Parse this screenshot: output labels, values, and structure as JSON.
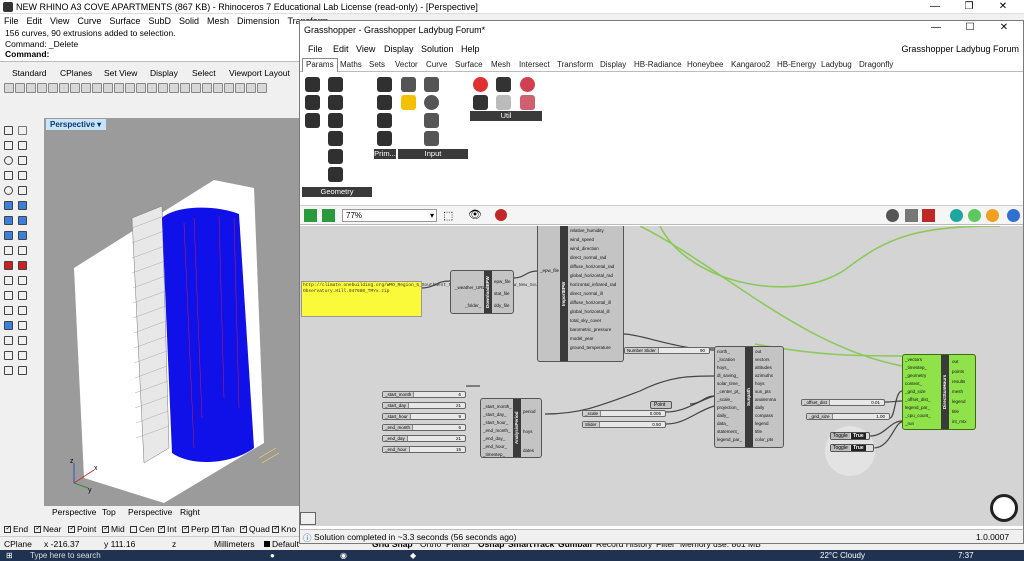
{
  "rhino": {
    "title": "NEW RHINO A3 COVE APARTMENTS (867 KB) - Rhinoceros 7 Educational Lab License (read-only) - [Perspective]",
    "menu": [
      "File",
      "Edit",
      "View",
      "Curve",
      "Surface",
      "SubD",
      "Solid",
      "Mesh",
      "Dimension",
      "Transform"
    ],
    "command_history": [
      "156 curves, 90 extrusions added to selection.",
      "Command: _Delete"
    ],
    "command_prompt": "Command:",
    "toolbar_tabs": [
      "Standard",
      "CPlanes",
      "Set View",
      "Display",
      "Select",
      "Viewport Layout"
    ],
    "viewport_label": "Perspective",
    "viewport_tabs": [
      "Perspective",
      "Top",
      "Perspective",
      "Right"
    ],
    "osnaps": [
      {
        "label": "End",
        "checked": true
      },
      {
        "label": "Near",
        "checked": true
      },
      {
        "label": "Point",
        "checked": true
      },
      {
        "label": "Mid",
        "checked": true
      },
      {
        "label": "Cen",
        "checked": false
      },
      {
        "label": "Int",
        "checked": true
      },
      {
        "label": "Perp",
        "checked": true
      },
      {
        "label": "Tan",
        "checked": true
      },
      {
        "label": "Quad",
        "checked": true
      },
      {
        "label": "Kno",
        "checked": true
      }
    ],
    "status": {
      "cplane": "CPlane",
      "x": "x -216.37",
      "y": "y 111.16",
      "z": "z",
      "units": "Millimeters",
      "layer": "Default",
      "toggles": [
        "Grid Snap",
        "Ortho",
        "Planar",
        "Osnap",
        "SmartTrack",
        "Gumball",
        "Record History",
        "Filter",
        "Memory use: 861 MB"
      ]
    },
    "axis_labels": {
      "x": "x",
      "y": "y",
      "z": "z"
    }
  },
  "grasshopper": {
    "title": "Grasshopper - Grasshopper Ladybug Forum*",
    "menu": [
      "File",
      "Edit",
      "View",
      "Display",
      "Solution",
      "Help"
    ],
    "doc_name": "Grasshopper Ladybug Forum",
    "tabs": [
      "Params",
      "Maths",
      "Sets",
      "Vector",
      "Curve",
      "Surface",
      "Mesh",
      "Intersect",
      "Transform",
      "Display",
      "HB-Radiance",
      "Honeybee",
      "Kangaroo2",
      "HB-Energy",
      "Ladybug",
      "Dragonfly"
    ],
    "active_tab": "Params",
    "ribbon_groups": [
      "Geometry",
      "Prim...",
      "Input",
      "Util"
    ],
    "zoom": "77%",
    "status": "Solution completed in ~3.3 seconds (56 seconds ago)",
    "version": "1.0.0007",
    "panel_url": "http://climate.onebuilding.org/WMO_Region_5_Southwest_Pacific/AUS_Australia/NSW_New_South_Wales/AUS_NSW_Sydney.Obs-Observatory.Hill.947680_TMYx.zip",
    "components": {
      "download": {
        "title": "DownloadEPW",
        "inputs": [
          "_weather_URL",
          "_folder_"
        ],
        "outputs": [
          "epw_file",
          "stat_file",
          "ddy_file"
        ]
      },
      "import": {
        "title": "ImportEPW",
        "inputs": [
          "_epw_file"
        ],
        "outputs": [
          "relative_humidity",
          "wind_speed",
          "wind_direction",
          "direct_normal_rad",
          "diffuse_horizontal_rad",
          "global_horizontal_rad",
          "horizontal_infrared_rad",
          "direct_normal_ill",
          "diffuse_horizontal_ill",
          "global_horizontal_ill",
          "total_sky_cover",
          "barometric_pressure",
          "model_year",
          "ground_temperature"
        ]
      },
      "sunpath": {
        "title": "Sunpath",
        "inputs": [
          "north_",
          "_location",
          "hoys_",
          "dl_saving_",
          "solar_time_",
          "_center_pt_",
          "_scale_",
          "projection_",
          "daily_",
          "data_",
          "statement_",
          "legend_par_"
        ],
        "outputs": [
          "out",
          "vectors",
          "altitudes",
          "azimuths",
          "hoys",
          "sun_pts",
          "analemma",
          "daily",
          "compass",
          "legend",
          "title",
          "color_pts"
        ]
      },
      "analysis": {
        "title": "AnalysisPeriod",
        "inputs": [
          "_start_month_",
          "_start_day_",
          "_start_hour_",
          "_end_month_",
          "_end_day_",
          "_end_hour_",
          "_timestep_"
        ],
        "outputs": [
          "period",
          "hoys",
          "dates"
        ]
      },
      "direct": {
        "title": "DirectSunHours",
        "inputs": [
          "_vectors",
          "_timestep_",
          "_geometry",
          "context_",
          "_grid_size",
          "_offset_dist_",
          "legend_par_",
          "_cpu_count_",
          "_run"
        ],
        "outputs": [
          "out",
          "points",
          "results",
          "mesh",
          "legend",
          "title",
          "int_mtx"
        ]
      }
    },
    "sliders": [
      {
        "name": "_start_month",
        "value": "6"
      },
      {
        "name": "_start_day",
        "value": "21"
      },
      {
        "name": "_start_hour",
        "value": "9"
      },
      {
        "name": "_end_month",
        "value": "6"
      },
      {
        "name": "_end_day",
        "value": "21"
      },
      {
        "name": "_end_hour",
        "value": "15"
      },
      {
        "name": "Number Slider",
        "value": "90"
      },
      {
        "name": "_scale",
        "value": "0.005"
      },
      {
        "name": "Slider",
        "value": "0.50"
      },
      {
        "name": "_offset_dist",
        "value": "0.01"
      },
      {
        "name": "_grid_size",
        "value": "1.00"
      }
    ],
    "point_label": "Point",
    "toggles": [
      {
        "name": "Toggle",
        "value": "True"
      },
      {
        "name": "Toggle",
        "value": "True"
      }
    ]
  },
  "taskbar": {
    "search": "Type here to search",
    "time": "7:37",
    "weather": "22°C Cloudy"
  }
}
